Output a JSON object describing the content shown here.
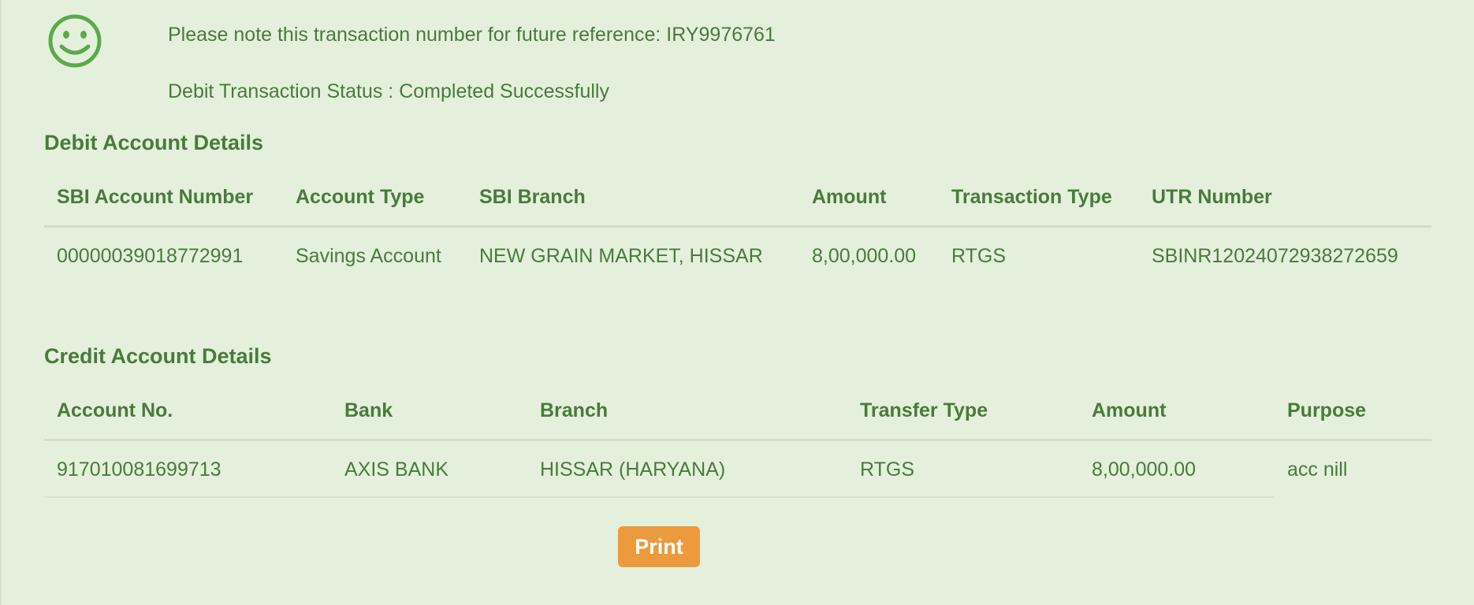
{
  "confirmation": {
    "icon": "smiley-icon",
    "reference_message": "Please note this transaction number for future reference: IRY9976761",
    "status_message": "Debit Transaction Status : Completed Successfully"
  },
  "debit": {
    "title": "Debit Account Details",
    "headers": [
      "SBI Account Number",
      "Account Type",
      "SBI Branch",
      "Amount",
      "Transaction Type",
      "UTR Number"
    ],
    "row": [
      "00000039018772991",
      "Savings Account",
      "NEW GRAIN MARKET, HISSAR",
      "8,00,000.00",
      "RTGS",
      "SBINR12024072938272659"
    ]
  },
  "credit": {
    "title": "Credit Account Details",
    "headers": [
      "Account No.",
      "Bank",
      "Branch",
      "Transfer Type",
      "Amount",
      "Purpose"
    ],
    "row": [
      "917010081699713",
      "AXIS BANK",
      "HISSAR (HARYANA)",
      "RTGS",
      "8,00,000.00",
      "acc nill"
    ]
  },
  "actions": {
    "print_label": "Print"
  },
  "colors": {
    "background": "#e4f0dc",
    "text": "#4a7a3c",
    "icon": "#5aaa4a",
    "button": "#eb9b3d"
  }
}
